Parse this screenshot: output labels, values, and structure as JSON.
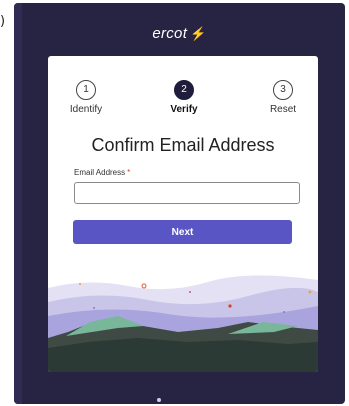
{
  "header": {
    "brand": "ercot",
    "brand_mark": "⚡"
  },
  "stepper": {
    "steps": [
      {
        "number": "1",
        "label": "Identify",
        "active": false
      },
      {
        "number": "2",
        "label": "Verify",
        "active": true
      },
      {
        "number": "3",
        "label": "Reset",
        "active": false
      }
    ]
  },
  "form": {
    "title": "Confirm Email Address",
    "email_label": "Email Address",
    "required_marker": "*",
    "email_value": "",
    "next_label": "Next"
  },
  "partial_glyph": ")",
  "colors": {
    "background": "#262343",
    "accent": "#5a55c4",
    "card": "#ffffff",
    "required": "#e03a2a"
  }
}
